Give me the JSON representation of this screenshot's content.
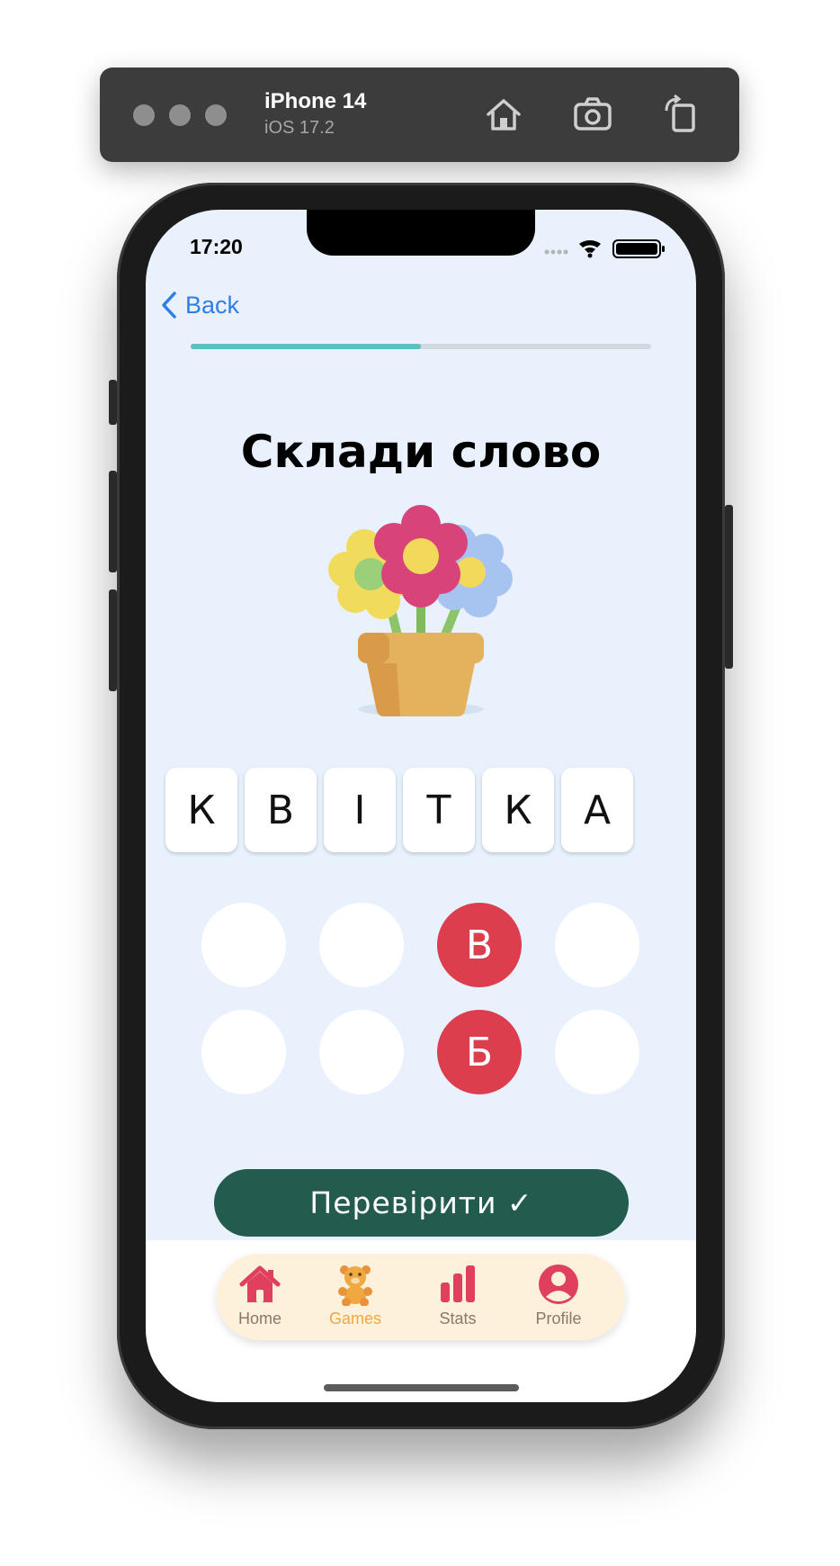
{
  "simulator": {
    "device": "iPhone 14",
    "os": "iOS 17.2",
    "buttons": [
      "home-icon",
      "screenshot-icon",
      "rotate-icon"
    ]
  },
  "status_bar": {
    "time": "17:20"
  },
  "nav": {
    "back_label": "Back"
  },
  "progress": {
    "fraction": 0.5
  },
  "game": {
    "title": "Склади слово",
    "picture": "flower-pot-icon",
    "word_letters": [
      "К",
      "В",
      "І",
      "Т",
      "К",
      "А"
    ],
    "slots": [
      {
        "letter": "",
        "selected": false
      },
      {
        "letter": "",
        "selected": false
      },
      {
        "letter": "В",
        "selected": true
      },
      {
        "letter": "",
        "selected": false
      },
      {
        "letter": "",
        "selected": false
      },
      {
        "letter": "",
        "selected": false
      },
      {
        "letter": "Б",
        "selected": true
      },
      {
        "letter": "",
        "selected": false
      }
    ],
    "check_label": "Перевірити ✓"
  },
  "tabs": [
    {
      "label": "Home",
      "icon": "house-icon",
      "active": false
    },
    {
      "label": "Games",
      "icon": "teddy-bear-icon",
      "active": true
    },
    {
      "label": "Stats",
      "icon": "bar-chart-icon",
      "active": false
    },
    {
      "label": "Profile",
      "icon": "person-icon",
      "active": false
    }
  ],
  "colors": {
    "background": "#e8f1fc",
    "accent_red": "#dc3e4e",
    "button_green": "#235b4e",
    "progress": "#5bc0c2",
    "tab_active": "#f0a840"
  }
}
